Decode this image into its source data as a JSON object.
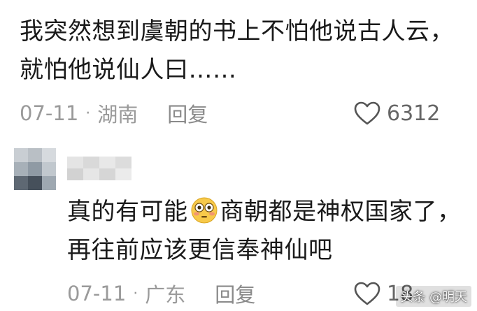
{
  "comment1": {
    "text_line1": "我突然想到虞朝的书上不怕他说古人云，",
    "text_line2": "就怕他说仙人曰……",
    "date": "07-11",
    "separator": "·",
    "location": "湖南",
    "reply_label": "回复",
    "likes": "6312"
  },
  "comment2": {
    "text_part1": "真的有可能",
    "emoji_icon": "flushed-face-emoji",
    "text_part2": "商朝都是神权国家了，",
    "text_line2": "再往前应该更信奉神仙吧",
    "date": "07-11",
    "separator": "·",
    "location": "广东",
    "reply_label": "回复",
    "likes_visible": "18"
  },
  "watermark": "头条 @明天",
  "colors": {
    "text": "#1a1a1a",
    "meta": "#9a9a9a",
    "heart_stroke": "#555555",
    "emoji_yellow": "#f7c94a"
  }
}
